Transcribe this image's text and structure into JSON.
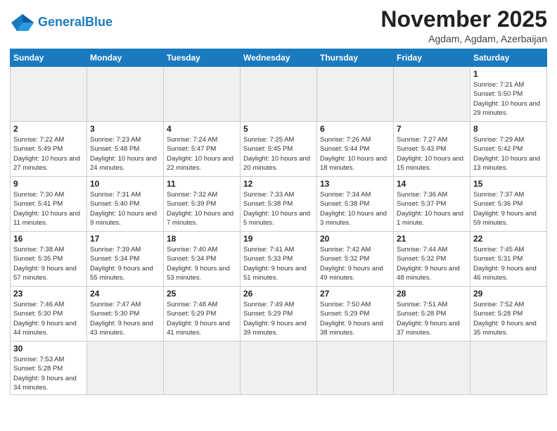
{
  "logo": {
    "text_general": "General",
    "text_blue": "Blue"
  },
  "header": {
    "month_title": "November 2025",
    "location": "Agdam, Agdam, Azerbaijan"
  },
  "weekdays": [
    "Sunday",
    "Monday",
    "Tuesday",
    "Wednesday",
    "Thursday",
    "Friday",
    "Saturday"
  ],
  "weeks": [
    [
      {
        "day": "",
        "empty": true
      },
      {
        "day": "",
        "empty": true
      },
      {
        "day": "",
        "empty": true
      },
      {
        "day": "",
        "empty": true
      },
      {
        "day": "",
        "empty": true
      },
      {
        "day": "",
        "empty": true
      },
      {
        "day": "1",
        "info": "Sunrise: 7:21 AM\nSunset: 5:50 PM\nDaylight: 10 hours and 29 minutes."
      }
    ],
    [
      {
        "day": "2",
        "info": "Sunrise: 7:22 AM\nSunset: 5:49 PM\nDaylight: 10 hours and 27 minutes."
      },
      {
        "day": "3",
        "info": "Sunrise: 7:23 AM\nSunset: 5:48 PM\nDaylight: 10 hours and 24 minutes."
      },
      {
        "day": "4",
        "info": "Sunrise: 7:24 AM\nSunset: 5:47 PM\nDaylight: 10 hours and 22 minutes."
      },
      {
        "day": "5",
        "info": "Sunrise: 7:25 AM\nSunset: 5:45 PM\nDaylight: 10 hours and 20 minutes."
      },
      {
        "day": "6",
        "info": "Sunrise: 7:26 AM\nSunset: 5:44 PM\nDaylight: 10 hours and 18 minutes."
      },
      {
        "day": "7",
        "info": "Sunrise: 7:27 AM\nSunset: 5:43 PM\nDaylight: 10 hours and 15 minutes."
      },
      {
        "day": "8",
        "info": "Sunrise: 7:29 AM\nSunset: 5:42 PM\nDaylight: 10 hours and 13 minutes."
      }
    ],
    [
      {
        "day": "9",
        "info": "Sunrise: 7:30 AM\nSunset: 5:41 PM\nDaylight: 10 hours and 11 minutes."
      },
      {
        "day": "10",
        "info": "Sunrise: 7:31 AM\nSunset: 5:40 PM\nDaylight: 10 hours and 9 minutes."
      },
      {
        "day": "11",
        "info": "Sunrise: 7:32 AM\nSunset: 5:39 PM\nDaylight: 10 hours and 7 minutes."
      },
      {
        "day": "12",
        "info": "Sunrise: 7:33 AM\nSunset: 5:38 PM\nDaylight: 10 hours and 5 minutes."
      },
      {
        "day": "13",
        "info": "Sunrise: 7:34 AM\nSunset: 5:38 PM\nDaylight: 10 hours and 3 minutes."
      },
      {
        "day": "14",
        "info": "Sunrise: 7:36 AM\nSunset: 5:37 PM\nDaylight: 10 hours and 1 minute."
      },
      {
        "day": "15",
        "info": "Sunrise: 7:37 AM\nSunset: 5:36 PM\nDaylight: 9 hours and 59 minutes."
      }
    ],
    [
      {
        "day": "16",
        "info": "Sunrise: 7:38 AM\nSunset: 5:35 PM\nDaylight: 9 hours and 57 minutes."
      },
      {
        "day": "17",
        "info": "Sunrise: 7:39 AM\nSunset: 5:34 PM\nDaylight: 9 hours and 55 minutes."
      },
      {
        "day": "18",
        "info": "Sunrise: 7:40 AM\nSunset: 5:34 PM\nDaylight: 9 hours and 53 minutes."
      },
      {
        "day": "19",
        "info": "Sunrise: 7:41 AM\nSunset: 5:33 PM\nDaylight: 9 hours and 51 minutes."
      },
      {
        "day": "20",
        "info": "Sunrise: 7:42 AM\nSunset: 5:32 PM\nDaylight: 9 hours and 49 minutes."
      },
      {
        "day": "21",
        "info": "Sunrise: 7:44 AM\nSunset: 5:32 PM\nDaylight: 9 hours and 48 minutes."
      },
      {
        "day": "22",
        "info": "Sunrise: 7:45 AM\nSunset: 5:31 PM\nDaylight: 9 hours and 46 minutes."
      }
    ],
    [
      {
        "day": "23",
        "info": "Sunrise: 7:46 AM\nSunset: 5:30 PM\nDaylight: 9 hours and 44 minutes."
      },
      {
        "day": "24",
        "info": "Sunrise: 7:47 AM\nSunset: 5:30 PM\nDaylight: 9 hours and 43 minutes."
      },
      {
        "day": "25",
        "info": "Sunrise: 7:48 AM\nSunset: 5:29 PM\nDaylight: 9 hours and 41 minutes."
      },
      {
        "day": "26",
        "info": "Sunrise: 7:49 AM\nSunset: 5:29 PM\nDaylight: 9 hours and 39 minutes."
      },
      {
        "day": "27",
        "info": "Sunrise: 7:50 AM\nSunset: 5:29 PM\nDaylight: 9 hours and 38 minutes."
      },
      {
        "day": "28",
        "info": "Sunrise: 7:51 AM\nSunset: 5:28 PM\nDaylight: 9 hours and 37 minutes."
      },
      {
        "day": "29",
        "info": "Sunrise: 7:52 AM\nSunset: 5:28 PM\nDaylight: 9 hours and 35 minutes."
      }
    ],
    [
      {
        "day": "30",
        "info": "Sunrise: 7:53 AM\nSunset: 5:28 PM\nDaylight: 9 hours and 34 minutes."
      },
      {
        "day": "",
        "empty": true
      },
      {
        "day": "",
        "empty": true
      },
      {
        "day": "",
        "empty": true
      },
      {
        "day": "",
        "empty": true
      },
      {
        "day": "",
        "empty": true
      },
      {
        "day": "",
        "empty": true
      }
    ]
  ]
}
